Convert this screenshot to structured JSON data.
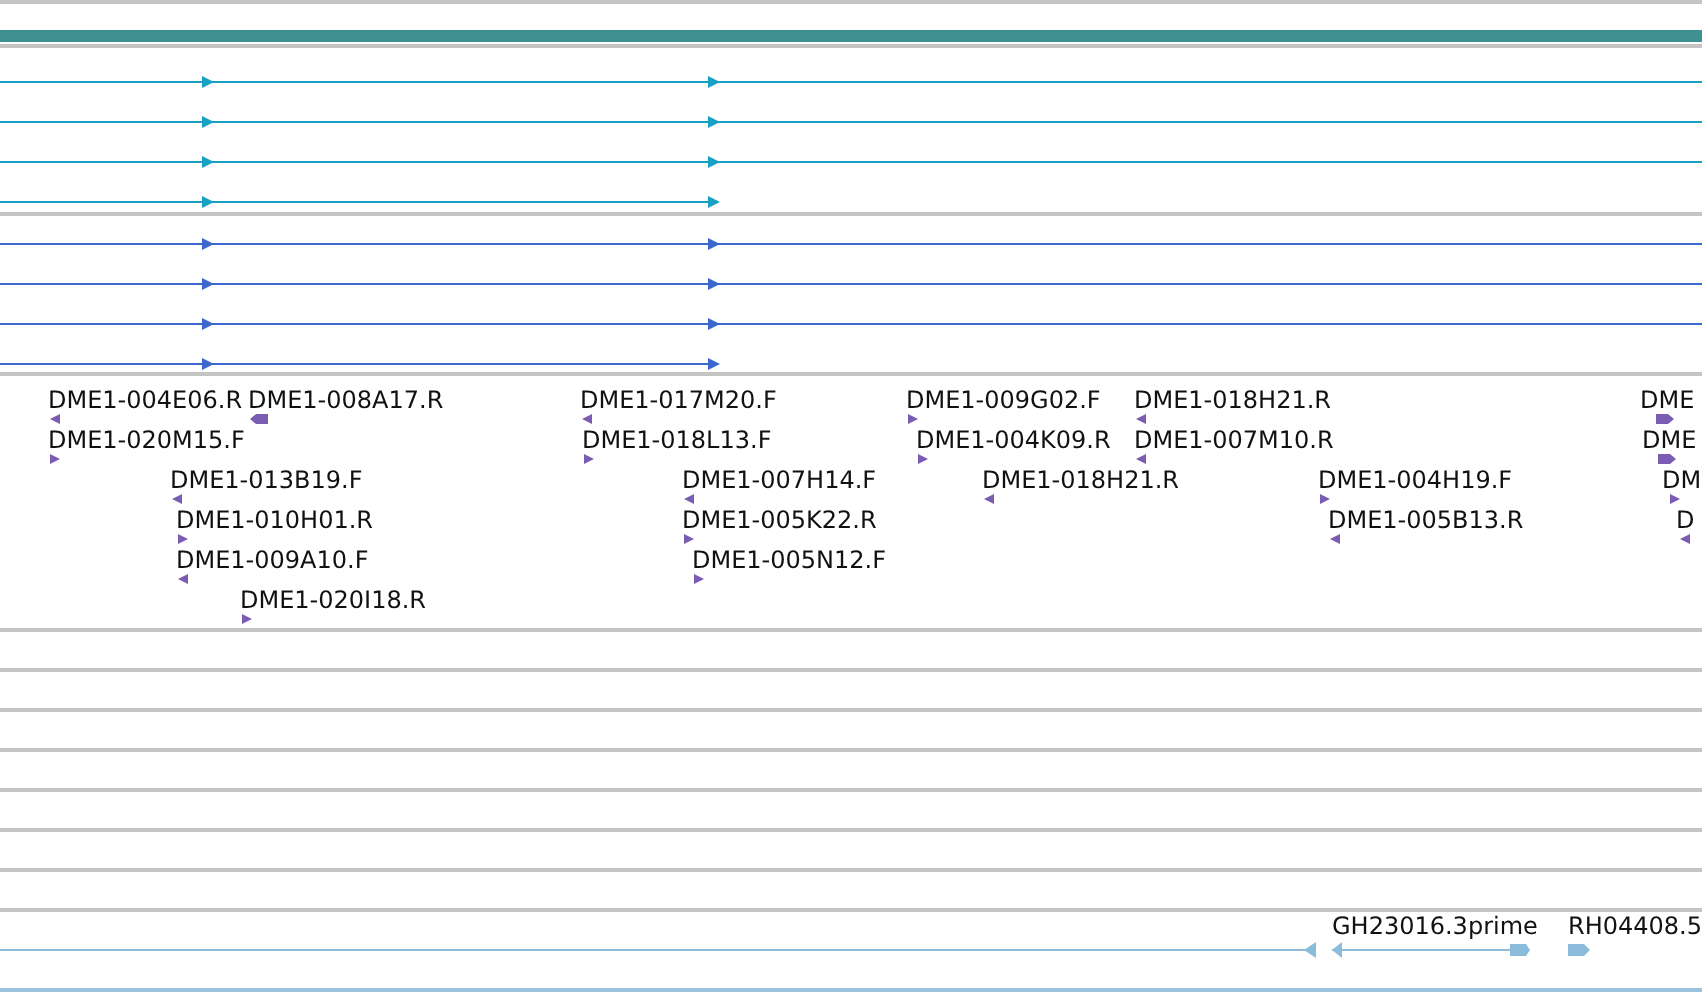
{
  "alignment_tracks": [
    {
      "color": "#1aa0c4"
    },
    {
      "color": "#3a68cc"
    }
  ],
  "features": [
    {
      "label": "DME1-004E06.R",
      "reverse": true
    },
    {
      "label": "DME1-008A17.R",
      "reverse": true
    },
    {
      "label": "DME1-017M20.F",
      "reverse": true
    },
    {
      "label": "DME1-009G02.F",
      "reverse": false
    },
    {
      "label": "DME1-018H21.R",
      "reverse": true
    },
    {
      "label": "DME",
      "reverse": false
    },
    {
      "label": "DME1-020M15.F",
      "reverse": false
    },
    {
      "label": "DME1-018L13.F",
      "reverse": false
    },
    {
      "label": "DME1-004K09.R",
      "reverse": false
    },
    {
      "label": "DME1-007M10.R",
      "reverse": true
    },
    {
      "label": "DME",
      "reverse": false
    },
    {
      "label": "DME1-013B19.F",
      "reverse": true
    },
    {
      "label": "DME1-007H14.F",
      "reverse": true
    },
    {
      "label": "DME1-018H21.R",
      "reverse": true
    },
    {
      "label": "DME1-004H19.F",
      "reverse": false
    },
    {
      "label": "DM",
      "reverse": false
    },
    {
      "label": "DME1-010H01.R",
      "reverse": false
    },
    {
      "label": "DME1-005K22.R",
      "reverse": false
    },
    {
      "label": "DME1-005B13.R",
      "reverse": true
    },
    {
      "label": "D",
      "reverse": true
    },
    {
      "label": "DME1-009A10.F",
      "reverse": true
    },
    {
      "label": "DME1-005N12.F",
      "reverse": false
    },
    {
      "label": "DME1-020I18.R",
      "reverse": false
    }
  ],
  "est_track": {
    "labels": [
      "GH23016.3prime",
      "RH04408.5"
    ]
  }
}
